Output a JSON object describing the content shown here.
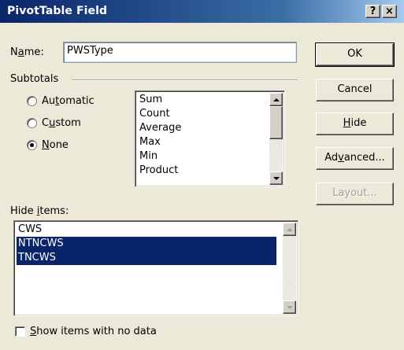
{
  "window": {
    "title": "PivotTable Field",
    "help_label": "?",
    "close_label": "×"
  },
  "name_field": {
    "label_pre": "N",
    "label_access": "a",
    "label_post": "me:",
    "value": "PWSType"
  },
  "subtotals": {
    "group_label": "Subtotals",
    "options": [
      {
        "pre": "Au",
        "access": "t",
        "post": "omatic",
        "checked": false
      },
      {
        "pre": "C",
        "access": "u",
        "post": "stom",
        "checked": false
      },
      {
        "pre": "",
        "access": "N",
        "post": "one",
        "checked": true
      }
    ],
    "functions": [
      "Sum",
      "Count",
      "Average",
      "Max",
      "Min",
      "Product"
    ]
  },
  "hide_items": {
    "label_pre": "Hide ",
    "label_access": "i",
    "label_post": "tems:",
    "items": [
      {
        "text": "CWS",
        "selected": false
      },
      {
        "text": "NTNCWS",
        "selected": true
      },
      {
        "text": "TNCWS",
        "selected": true
      }
    ]
  },
  "show_no_data": {
    "pre": "",
    "access": "S",
    "post": "how items with no data",
    "checked": false
  },
  "buttons": {
    "ok": "OK",
    "cancel": "Cancel",
    "hide_pre": "",
    "hide_access": "H",
    "hide_post": "ide",
    "advanced_pre": "Ad",
    "advanced_access": "v",
    "advanced_post": "anced...",
    "layout": "Layout..."
  },
  "colors": {
    "title_bar": "#0a246a",
    "selection": "#0a246a",
    "dialog_bg": "#ece9d8"
  }
}
